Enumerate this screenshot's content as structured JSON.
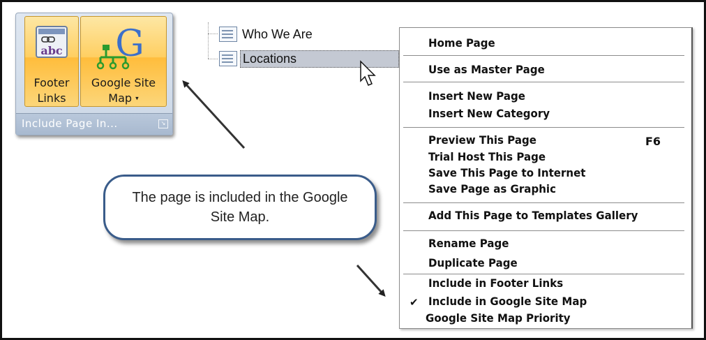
{
  "ribbon": {
    "footer_links_label": "Footer Links",
    "google_site_map_label": "Google Site Map",
    "dropdown_glyph": "▾",
    "group_label": "Include Page In...",
    "launcher_glyph": "↘"
  },
  "tree": {
    "items": [
      {
        "label": "Who We Are"
      },
      {
        "label": "Locations"
      }
    ]
  },
  "context_menu": {
    "items": [
      {
        "label": "Home Page"
      },
      {
        "label": "Use as Master Page"
      },
      {
        "label": "Insert New Page"
      },
      {
        "label": "Insert New Category"
      },
      {
        "label": "Preview This Page",
        "shortcut": "F6"
      },
      {
        "label": "Trial Host This Page"
      },
      {
        "label": "Save This Page to Internet"
      },
      {
        "label": "Save Page as Graphic"
      },
      {
        "label": "Add This Page to Templates Gallery"
      },
      {
        "label": "Rename Page"
      },
      {
        "label": "Duplicate Page"
      },
      {
        "label": "Include in Footer Links"
      },
      {
        "label": "Include in Google Site Map",
        "checked": true
      },
      {
        "label": "Google Site Map Priority"
      }
    ],
    "check_glyph": "✔"
  },
  "callout": {
    "text": "The page is included in the Google Site Map."
  },
  "colors": {
    "ribbon_button": "#ffcf62",
    "callout_border": "#3a5c8a",
    "selection": "#c4c9d3"
  }
}
